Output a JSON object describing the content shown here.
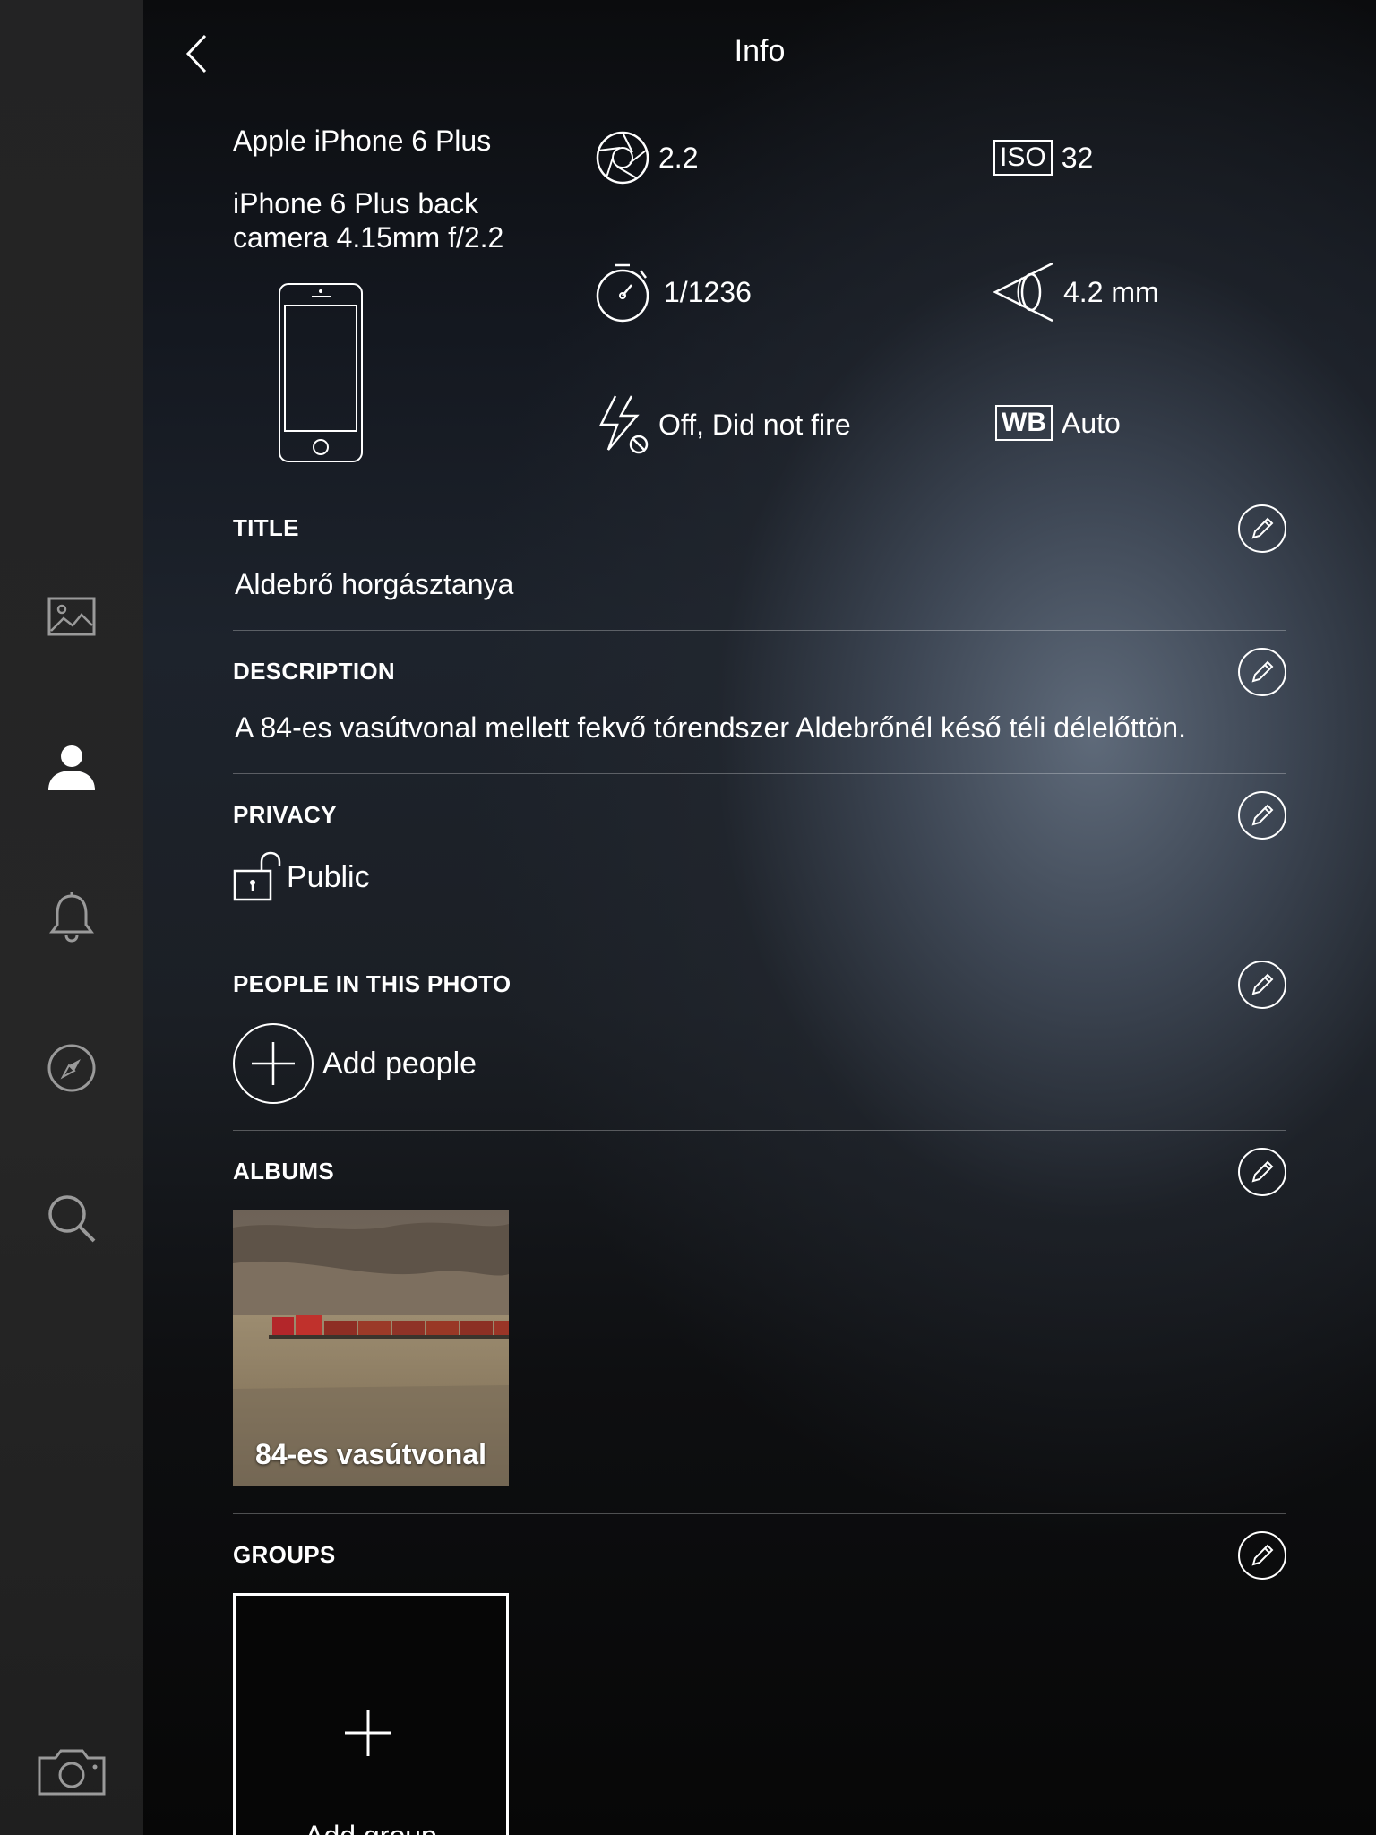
{
  "header": {
    "title": "Info",
    "back_icon": "chevron-left-icon"
  },
  "sidebar": {
    "items": [
      {
        "name": "photos",
        "icon": "image-icon"
      },
      {
        "name": "profile",
        "icon": "person-icon",
        "active": true
      },
      {
        "name": "notifications",
        "icon": "bell-icon"
      },
      {
        "name": "discover",
        "icon": "compass-icon"
      },
      {
        "name": "search",
        "icon": "search-icon"
      }
    ],
    "camera_icon": "camera-icon"
  },
  "camera": {
    "model": "Apple iPhone 6 Plus",
    "lens": "iPhone 6 Plus back camera 4.15mm f/2.2"
  },
  "exif": {
    "aperture": "2.2",
    "iso_badge": "ISO",
    "iso": "32",
    "shutter": "1/1236",
    "focal_length": "4.2 mm",
    "flash": "Off, Did not fire",
    "wb_badge": "WB",
    "white_balance": "Auto"
  },
  "sections": {
    "title": {
      "label": "TITLE",
      "value": "Aldebrő horgásztanya"
    },
    "description": {
      "label": "DESCRIPTION",
      "value": "A 84-es vasútvonal mellett fekvő tórendszer Aldebrőnél késő téli délelőttön."
    },
    "privacy": {
      "label": "PRIVACY",
      "value": "Public"
    },
    "people": {
      "label": "PEOPLE IN THIS PHOTO",
      "add_label": "Add people"
    },
    "albums": {
      "label": "ALBUMS",
      "items": [
        {
          "name": "84-es vasútvonal"
        }
      ]
    },
    "groups": {
      "label": "GROUPS",
      "add_label": "Add group"
    }
  },
  "colors": {
    "sidebar_bg": "#242424",
    "text": "#ffffff"
  }
}
